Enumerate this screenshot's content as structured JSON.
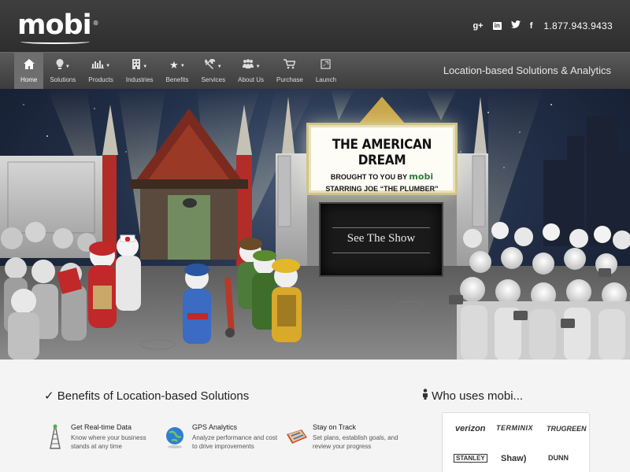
{
  "brand": {
    "logo": "mobi",
    "reg": "®"
  },
  "header": {
    "social": [
      {
        "name": "google-plus-icon",
        "glyph": "g+"
      },
      {
        "name": "linkedin-icon",
        "glyph": "in"
      },
      {
        "name": "twitter-icon",
        "glyph": "🐦"
      },
      {
        "name": "facebook-icon",
        "glyph": "f"
      }
    ],
    "phone": "1.877.943.9433"
  },
  "nav": {
    "items": [
      {
        "label": "Home",
        "icon": "home-icon",
        "glyph": "⌂",
        "active": true
      },
      {
        "label": "Solutions",
        "icon": "lightbulb-icon",
        "glyph": "💡"
      },
      {
        "label": "Products",
        "icon": "chart-icon",
        "glyph": "📊"
      },
      {
        "label": "Industries",
        "icon": "building-icon",
        "glyph": "🏢"
      },
      {
        "label": "Benefits",
        "icon": "star-icon",
        "glyph": "★"
      },
      {
        "label": "Services",
        "icon": "tools-icon",
        "glyph": "✂"
      },
      {
        "label": "About Us",
        "icon": "people-icon",
        "glyph": "👥"
      },
      {
        "label": "Purchase",
        "icon": "cart-icon",
        "glyph": "🛒"
      },
      {
        "label": "Launch",
        "icon": "launch-icon",
        "glyph": "▣"
      }
    ],
    "tagline": "Location-based Solutions & Analytics"
  },
  "hero": {
    "marquee": {
      "title": "THE AMERICAN DREAM",
      "line2_prefix": "BROUGHT TO YOU BY",
      "line2_brand": "mobi",
      "line3": "STARRING JOE “THE PLUMBER”"
    },
    "cta": "See The Show"
  },
  "benefits": {
    "title": "Benefits of Location-based Solutions",
    "items": [
      {
        "title": "Get Real-time Data",
        "desc": "Know where your business stands at any time",
        "icon": "tower-icon"
      },
      {
        "title": "GPS Analytics",
        "desc": "Analyze performance and cost to drive improvements",
        "icon": "globe-icon"
      },
      {
        "title": "Stay on Track",
        "desc": "Set plans, establish goals, and review your progress",
        "icon": "map-icon"
      }
    ]
  },
  "who": {
    "title": "Who uses mobi...",
    "clients": [
      "verizon",
      "TERMINIX",
      "TRUGREEN",
      "STANLEY",
      "Shaw)",
      "DUNN"
    ]
  },
  "colors": {
    "topbar": "#333333",
    "nav": "#4a4a4a",
    "hero_sky": "#1d2a40",
    "marquee_brand": "#2d7a3a"
  }
}
